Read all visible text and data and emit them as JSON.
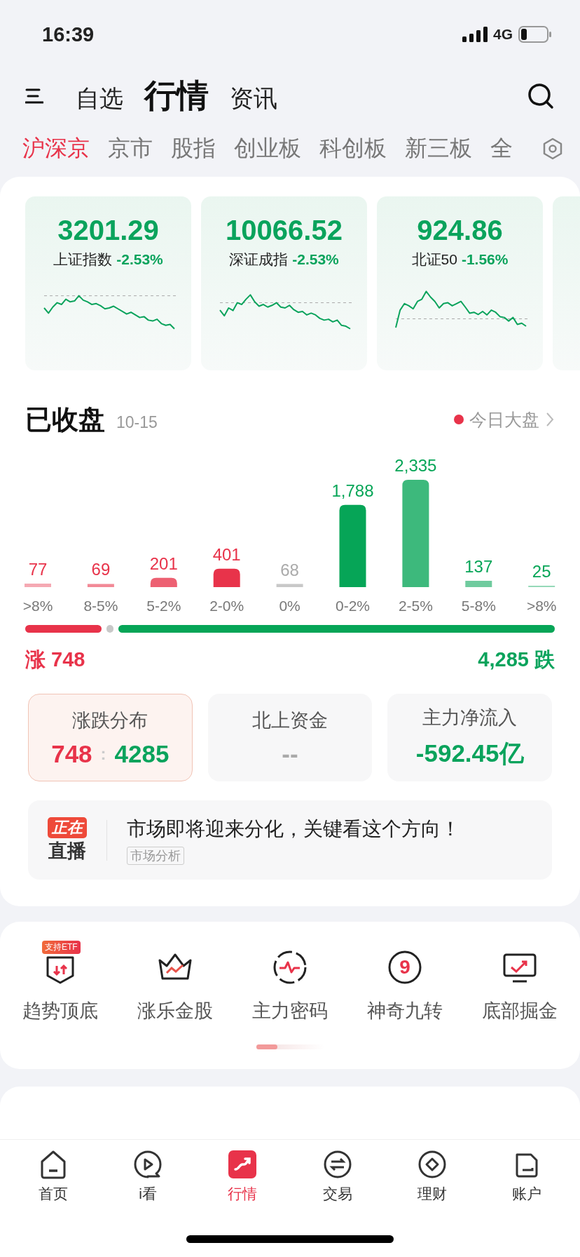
{
  "status_bar": {
    "time": "16:39",
    "network": "4G"
  },
  "header": {
    "tabs": [
      {
        "label": "自选",
        "selected": false
      },
      {
        "label": "行情",
        "selected": true
      },
      {
        "label": "资讯",
        "selected": false
      }
    ]
  },
  "market_tabs": [
    {
      "label": "沪深京",
      "selected": true
    },
    {
      "label": "京市",
      "selected": false
    },
    {
      "label": "股指",
      "selected": false
    },
    {
      "label": "创业板",
      "selected": false
    },
    {
      "label": "科创板",
      "selected": false
    },
    {
      "label": "新三板",
      "selected": false
    },
    {
      "label": "全",
      "selected": false
    }
  ],
  "indices": [
    {
      "value": "3201.29",
      "name": "上证指数",
      "change": "-2.53%",
      "falling": true
    },
    {
      "value": "10066.52",
      "name": "深证成指",
      "change": "-2.53%",
      "falling": true
    },
    {
      "value": "924.86",
      "name": "北证50",
      "change": "-1.56%",
      "falling": true
    }
  ],
  "market": {
    "title": "已收盘",
    "date": "10-15",
    "link": "今日大盘"
  },
  "distribution": {
    "chart_data": {
      "type": "bar",
      "categories": [
        ">8%",
        "8-5%",
        "5-2%",
        "2-0%",
        "0%",
        "0-2%",
        "2-5%",
        "5-8%",
        ">8%"
      ],
      "values": [
        77,
        69,
        201,
        401,
        68,
        1788,
        2335,
        137,
        25
      ],
      "value_labels": [
        "77",
        "69",
        "201",
        "401",
        "68",
        "1,788",
        "2,335",
        "137",
        "25"
      ]
    },
    "up_label": "涨",
    "up_count": "748",
    "down_count": "4,285",
    "down_label": "跌"
  },
  "stats": [
    {
      "kind": "ratio",
      "label": "涨跌分布",
      "up": "748",
      "separator": ":",
      "down": "4285",
      "selected": true
    },
    {
      "kind": "value",
      "label": "北上资金",
      "value": "--",
      "falling": false,
      "selected": false
    },
    {
      "kind": "value",
      "label": "主力净流入",
      "value": "-592.45亿",
      "falling": true,
      "selected": false
    }
  ],
  "live": {
    "badge_top": "正在",
    "badge_bottom": "直播",
    "title": "市场即将迎来分化，关键看这个方向！",
    "tag": "市场分析"
  },
  "tools": [
    {
      "label": "趋势顶底",
      "badge": "支持ETF"
    },
    {
      "label": "涨乐金股"
    },
    {
      "label": "主力密码"
    },
    {
      "label": "神奇九转",
      "glyph": "9"
    },
    {
      "label": "底部掘金"
    }
  ],
  "bottom_nav": [
    {
      "label": "首页",
      "selected": false
    },
    {
      "label": "i看",
      "selected": false
    },
    {
      "label": "行情",
      "selected": true
    },
    {
      "label": "交易",
      "selected": false
    },
    {
      "label": "理财",
      "selected": false
    },
    {
      "label": "账户",
      "selected": false
    }
  ]
}
